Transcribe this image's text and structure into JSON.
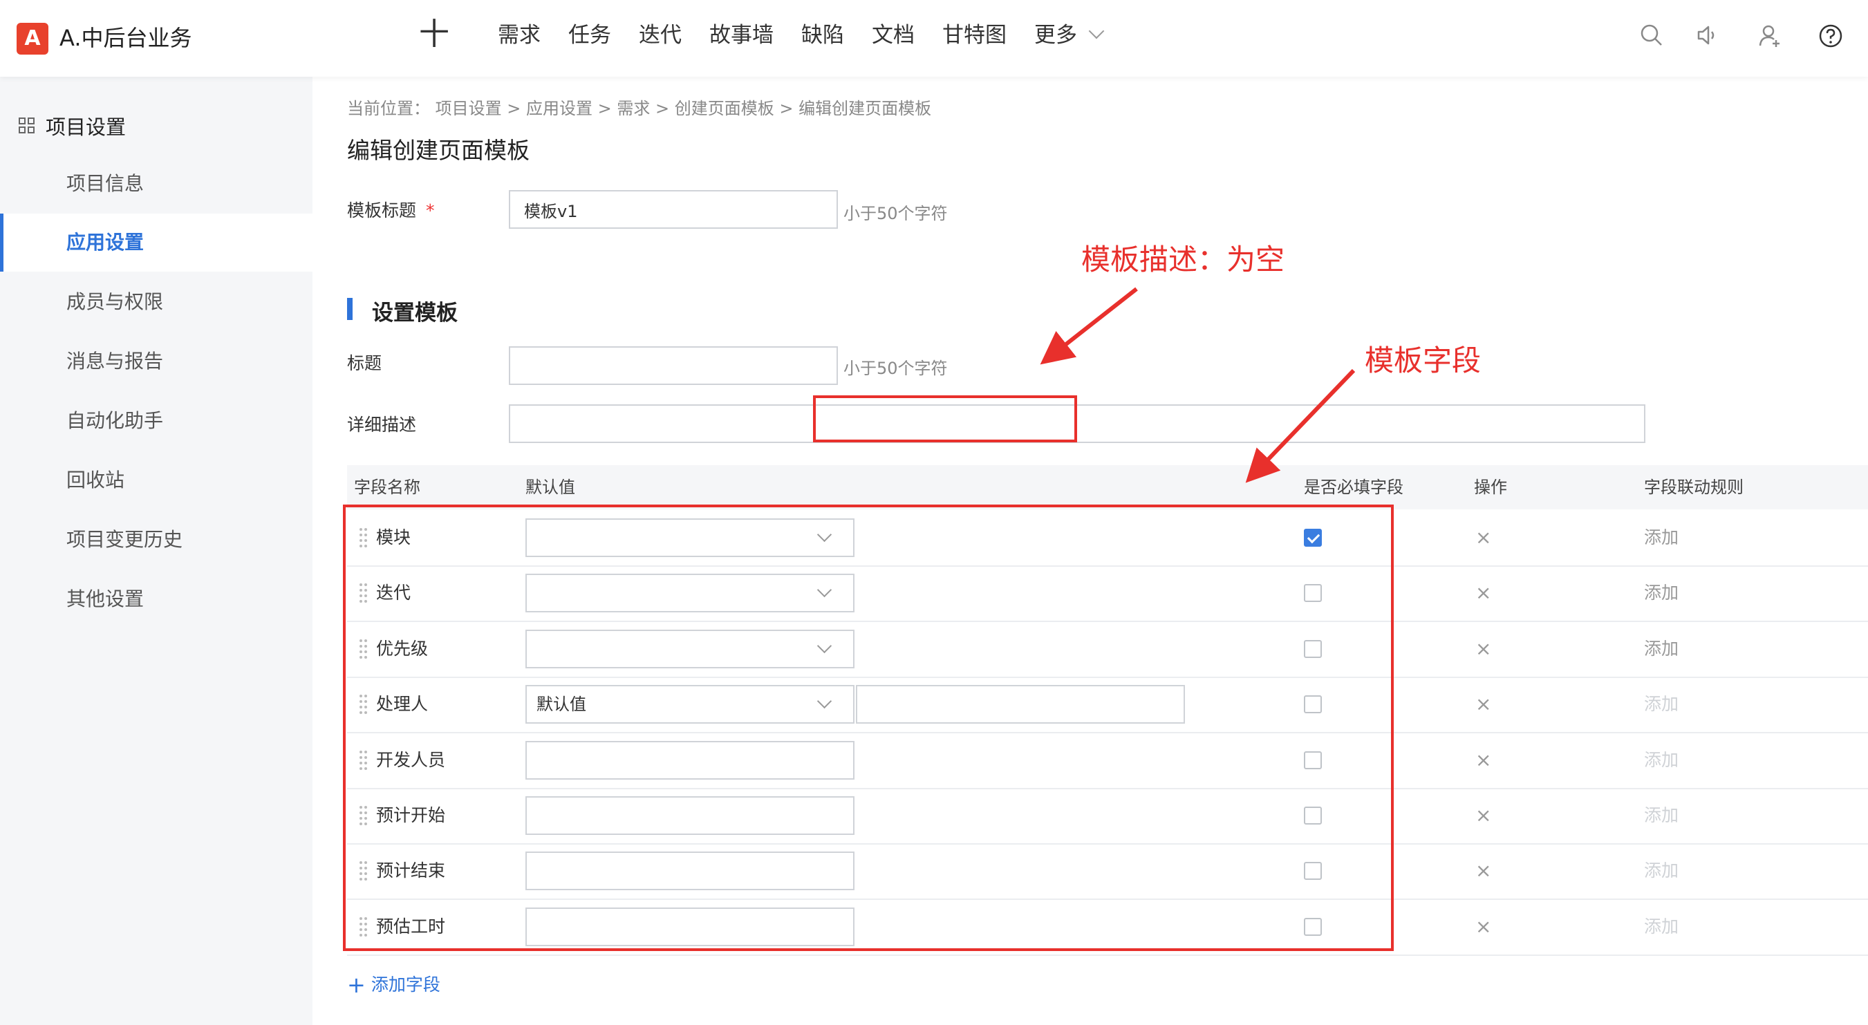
{
  "header": {
    "logo_letter": "A",
    "app_title": "A.中后台业务",
    "plus": "十",
    "nav": [
      "需求",
      "任务",
      "迭代",
      "故事墙",
      "缺陷",
      "文档",
      "甘特图",
      "更多"
    ],
    "icons": [
      "search-icon",
      "speaker-icon",
      "user-add-icon",
      "help-icon"
    ]
  },
  "sidebar": {
    "title": "项目设置",
    "items": [
      "项目信息",
      "应用设置",
      "成员与权限",
      "消息与报告",
      "自动化助手",
      "回收站",
      "项目变更历史",
      "其他设置"
    ],
    "active_index": 1
  },
  "main": {
    "breadcrumb": "当前位置： 项目设置 > 应用设置 > 需求 > 创建页面模板 > 编辑创建页面模板",
    "page_title": "编辑创建页面模板",
    "template_title_label": "模板标题",
    "required_mark": "*",
    "template_title_value": "模板v1",
    "template_title_hint": "小于50个字符",
    "section_title": "设置模板",
    "title_label": "标题",
    "title_value": "",
    "title_hint": "小于50个字符",
    "desc_label": "详细描述",
    "desc_value": "",
    "table": {
      "headers": [
        "字段名称",
        "默认值",
        "是否必填字段",
        "操作",
        "字段联动规则"
      ],
      "rows": [
        {
          "name": "模块",
          "type": "select",
          "value": "",
          "required": true,
          "action": "×",
          "rule": "添加",
          "rule_enabled": true
        },
        {
          "name": "迭代",
          "type": "select",
          "value": "",
          "required": false,
          "action": "×",
          "rule": "添加",
          "rule_enabled": true
        },
        {
          "name": "优先级",
          "type": "select",
          "value": "",
          "required": false,
          "action": "×",
          "rule": "添加",
          "rule_enabled": true
        },
        {
          "name": "处理人",
          "type": "select+input",
          "value": "默认值",
          "required": false,
          "action": "×",
          "rule": "添加",
          "rule_enabled": false
        },
        {
          "name": "开发人员",
          "type": "input",
          "value": "",
          "required": false,
          "action": "×",
          "rule": "添加",
          "rule_enabled": false
        },
        {
          "name": "预计开始",
          "type": "input",
          "value": "",
          "required": false,
          "action": "×",
          "rule": "添加",
          "rule_enabled": false
        },
        {
          "name": "预计结束",
          "type": "input",
          "value": "",
          "required": false,
          "action": "×",
          "rule": "添加",
          "rule_enabled": false
        },
        {
          "name": "预估工时",
          "type": "input",
          "value": "",
          "required": false,
          "action": "×",
          "rule": "添加",
          "rule_enabled": false
        }
      ]
    },
    "add_field_plus": "+",
    "add_field": "添加字段"
  },
  "annotations": {
    "desc_note": "模板描述：为空",
    "fields_note": "模板字段",
    "color": "#e8302c"
  }
}
